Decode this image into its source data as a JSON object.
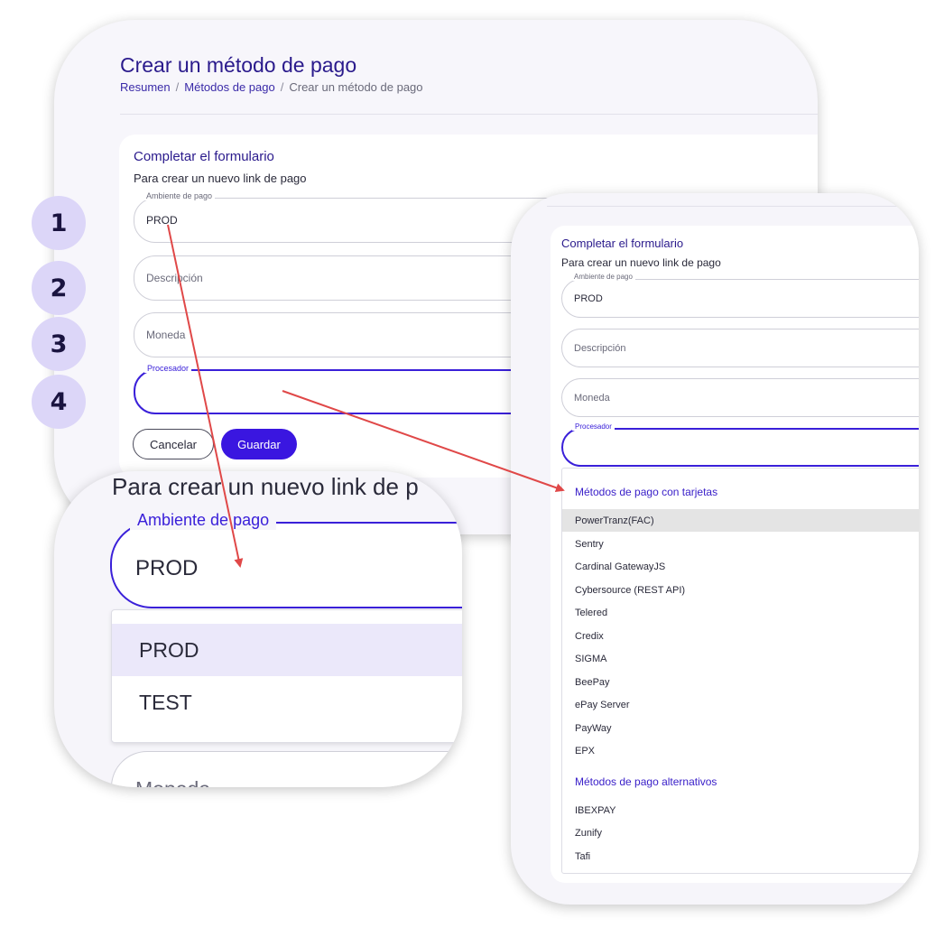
{
  "page": {
    "title": "Crear un método de pago",
    "breadcrumb": [
      "Resumen",
      "Métodos de pago",
      "Crear un método de pago"
    ],
    "breadcrumb_sep": "/"
  },
  "form": {
    "title": "Completar el formulario",
    "subtitle": "Para crear un nuevo link de pago",
    "environment": {
      "label": "Ambiente de pago",
      "value": "PROD"
    },
    "description": {
      "placeholder": "Descripción"
    },
    "currency": {
      "placeholder": "Moneda"
    },
    "processor": {
      "label": "Procesador",
      "value": ""
    },
    "cancel_label": "Cancelar",
    "save_label": "Guardar"
  },
  "steps": [
    "1",
    "2",
    "3",
    "4"
  ],
  "zoom": {
    "subtitle": "Para crear un nuevo link de p",
    "field_label": "Ambiente de pago",
    "field_value": "PROD",
    "options": [
      "PROD",
      "TEST"
    ],
    "selected": "PROD",
    "next_field": "Moneda"
  },
  "processor_menu": {
    "group_cards": "Métodos de pago con tarjetas",
    "cards": [
      "PowerTranz(FAC)",
      "Sentry",
      "Cardinal GatewayJS",
      "Cybersource (REST API)",
      "Telered",
      "Credix",
      "SIGMA",
      "BeePay",
      "ePay Server",
      "PayWay",
      "EPX"
    ],
    "highlighted": "PowerTranz(FAC)",
    "group_alt": "Métodos de pago alternativos",
    "alternatives": [
      "IBEXPAY",
      "Zunify",
      "Tafi"
    ]
  },
  "colors": {
    "accent": "#3a16e0",
    "title": "#2a1a8c",
    "step_bg": "#dcd6f8",
    "arrow": "#e04848"
  }
}
